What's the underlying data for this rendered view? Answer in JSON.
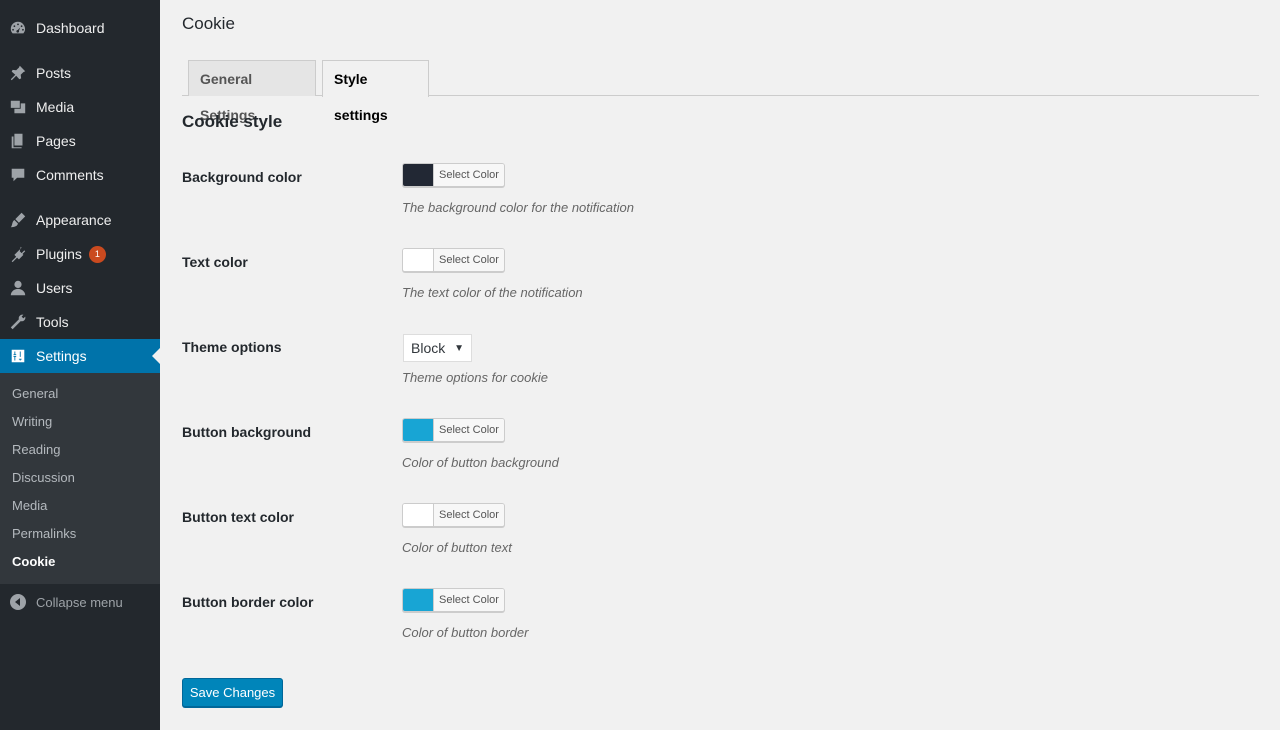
{
  "sidebar": {
    "menu": [
      {
        "label": "Dashboard",
        "icon": "dashboard-icon"
      },
      {
        "label": "Posts",
        "icon": "pin-icon"
      },
      {
        "label": "Media",
        "icon": "media-icon"
      },
      {
        "label": "Pages",
        "icon": "pages-icon"
      },
      {
        "label": "Comments",
        "icon": "comment-icon"
      },
      {
        "label": "Appearance",
        "icon": "brush-icon"
      },
      {
        "label": "Plugins",
        "icon": "plug-icon",
        "badge": "1"
      },
      {
        "label": "Users",
        "icon": "user-icon"
      },
      {
        "label": "Tools",
        "icon": "wrench-icon"
      },
      {
        "label": "Settings",
        "icon": "settings-icon",
        "active": true
      }
    ],
    "submenu": [
      "General",
      "Writing",
      "Reading",
      "Discussion",
      "Media",
      "Permalinks",
      "Cookie"
    ],
    "submenu_current": "Cookie",
    "collapse_label": "Collapse menu"
  },
  "page": {
    "title": "Cookie",
    "tabs": [
      {
        "label": "General Settings",
        "active": false
      },
      {
        "label": "Style settings",
        "active": true
      }
    ],
    "section_title": "Cookie style"
  },
  "settings": [
    {
      "label": "Background color",
      "type": "color",
      "value": "#222834",
      "button": "Select Color",
      "description": "The background color for the notification"
    },
    {
      "label": "Text color",
      "type": "color",
      "value": "#ffffff",
      "button": "Select Color",
      "description": "The text color of the notification"
    },
    {
      "label": "Theme options",
      "type": "select",
      "value": "Block",
      "description": "Theme options for cookie"
    },
    {
      "label": "Button background",
      "type": "color",
      "value": "#18a5d4",
      "button": "Select Color",
      "description": "Color of button background"
    },
    {
      "label": "Button text color",
      "type": "color",
      "value": "#ffffff",
      "button": "Select Color",
      "description": "Color of button text"
    },
    {
      "label": "Button border color",
      "type": "color",
      "value": "#18a5d4",
      "button": "Select Color",
      "description": "Color of button border"
    }
  ],
  "save_label": "Save Changes",
  "colors": {
    "sidebar_bg": "#23282d",
    "submenu_bg": "#32373c",
    "accent": "#0073aa",
    "button_primary": "#0085ba",
    "badge": "#ca4a1f"
  }
}
